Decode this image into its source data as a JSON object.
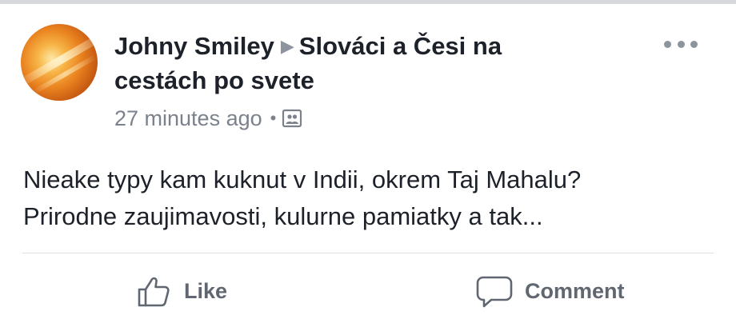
{
  "post": {
    "author": "Johny Smiley",
    "group_line1": "Slováci a Česi na",
    "group_line2": "cestách po svete",
    "timestamp": "27 minutes ago",
    "separator": "•",
    "audience_icon": "group-audience-icon",
    "text_line1": "Nieake typy kam kuknut v Indii, okrem Taj Mahalu?",
    "text_line2": "Prirodne zaujimavosti, kulurne pamiatky a tak..."
  },
  "actions": {
    "like_label": "Like",
    "comment_label": "Comment"
  },
  "colors": {
    "primary_text": "#1d2129",
    "secondary_text": "#7b828c",
    "action_text": "#606770",
    "divider": "#dddfe2"
  }
}
